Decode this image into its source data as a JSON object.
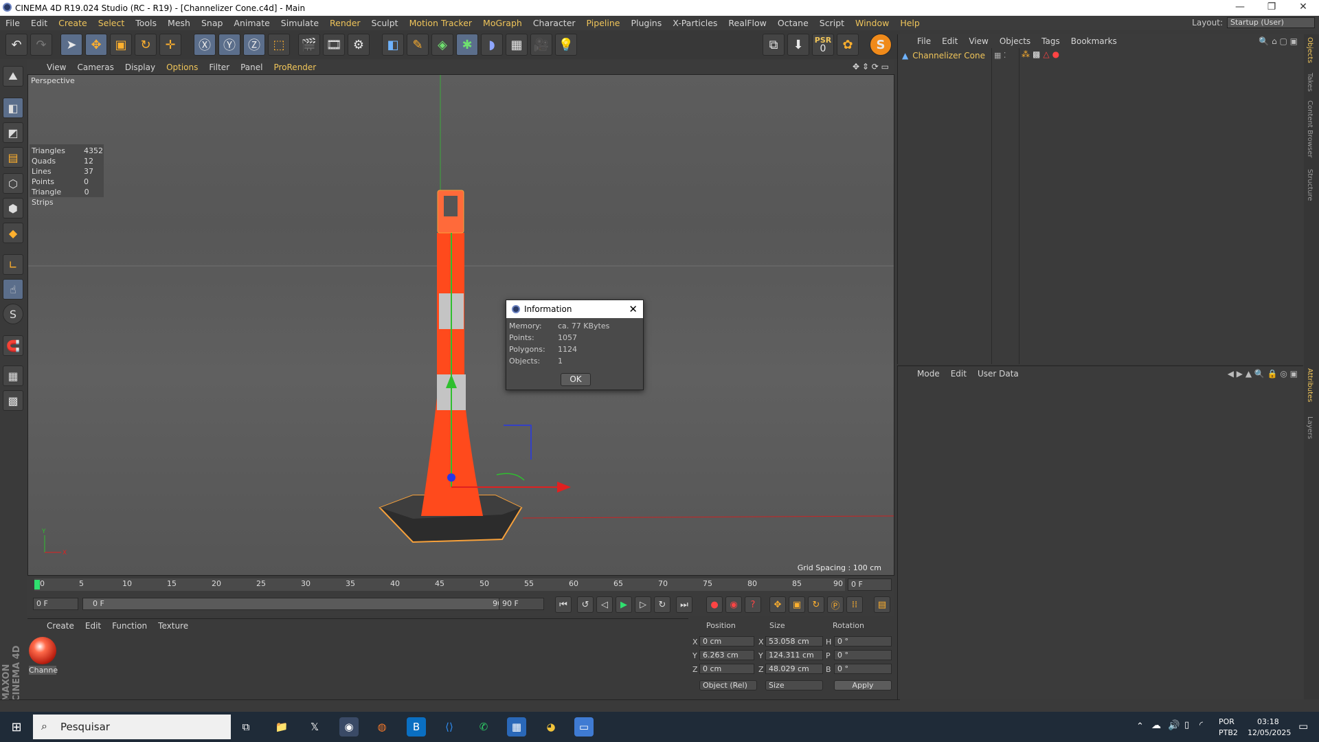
{
  "window": {
    "title": "CINEMA 4D R19.024 Studio (RC - R19) - [Channelizer Cone.c4d] - Main"
  },
  "menu": [
    "File",
    "Edit",
    "Create",
    "Select",
    "Tools",
    "Mesh",
    "Snap",
    "Animate",
    "Simulate",
    "Render",
    "Sculpt",
    "Motion Tracker",
    "MoGraph",
    "Character",
    "Pipeline",
    "Plugins",
    "X-Particles",
    "RealFlow",
    "Octane",
    "Script",
    "Window",
    "Help"
  ],
  "layout": {
    "label": "Layout:",
    "value": "Startup (User)"
  },
  "toolbar": {
    "psr_label": "PSR",
    "psr_value": "0"
  },
  "viewport": {
    "menu": [
      "View",
      "Cameras",
      "Display",
      "Options",
      "Filter",
      "Panel",
      "ProRender"
    ],
    "label": "Perspective",
    "grid_spacing": "Grid Spacing : 100 cm",
    "stats": [
      {
        "k": "Triangles",
        "v": "4352"
      },
      {
        "k": "Quads",
        "v": "12"
      },
      {
        "k": "Lines",
        "v": "37"
      },
      {
        "k": "Points",
        "v": "0"
      },
      {
        "k": "Triangle Strips",
        "v": "0"
      }
    ]
  },
  "dialog": {
    "title": "Information",
    "rows": [
      {
        "k": "Memory:",
        "v": "ca. 77 KBytes"
      },
      {
        "k": "Points:",
        "v": "1057"
      },
      {
        "k": "Polygons:",
        "v": "1124"
      },
      {
        "k": "Objects:",
        "v": "1"
      }
    ],
    "ok": "OK"
  },
  "timeline": {
    "ticks": [
      "0",
      "5",
      "10",
      "15",
      "20",
      "25",
      "30",
      "35",
      "40",
      "45",
      "50",
      "55",
      "60",
      "65",
      "70",
      "75",
      "80",
      "85",
      "90"
    ],
    "current": "0 F",
    "start": "0 F",
    "range_start": "0 F",
    "range_end": "90 F",
    "end": "90 F"
  },
  "material_manager": {
    "menu": [
      "Create",
      "Edit",
      "Function",
      "Texture"
    ],
    "material_name": "Channe"
  },
  "coords": {
    "headers": [
      "Position",
      "Size",
      "Rotation"
    ],
    "rows": [
      {
        "axis": "X",
        "pos": "0 cm",
        "saxis": "X",
        "size": "53.058 cm",
        "raxis": "H",
        "rot": "0 °"
      },
      {
        "axis": "Y",
        "pos": "6.263 cm",
        "saxis": "Y",
        "size": "124.311 cm",
        "raxis": "P",
        "rot": "0 °"
      },
      {
        "axis": "Z",
        "pos": "0 cm",
        "saxis": "Z",
        "size": "48.029 cm",
        "raxis": "B",
        "rot": "0 °"
      }
    ],
    "mode": "Object (Rel)",
    "size_mode": "Size",
    "apply": "Apply"
  },
  "object_manager": {
    "menu": [
      "File",
      "Edit",
      "View",
      "Objects",
      "Tags",
      "Bookmarks"
    ],
    "object_name": "Channelizer Cone"
  },
  "attribute_manager": {
    "menu": [
      "Mode",
      "Edit",
      "User Data"
    ]
  },
  "side_tabs": [
    "Objects",
    "Takes",
    "Content Browser",
    "Structure",
    "Attributes",
    "Layers"
  ],
  "brand": "MAXON CINEMA 4D",
  "taskbar": {
    "search": "Pesquisar",
    "lang1": "POR",
    "lang2": "PTB2",
    "time": "03:18",
    "date": "12/05/2025"
  },
  "colors": {
    "accent": "#f0c55a",
    "cone": "#ff4a1c",
    "viewport": "#5c5c5c"
  }
}
